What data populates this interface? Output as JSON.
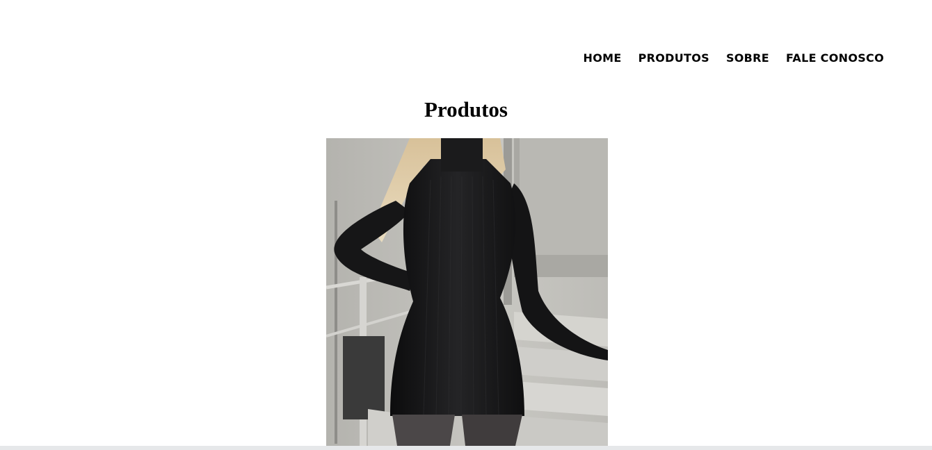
{
  "nav": {
    "items": [
      {
        "label": "HOME"
      },
      {
        "label": "PRODUTOS"
      },
      {
        "label": "SOBRE"
      },
      {
        "label": "FALE CONOSCO"
      }
    ]
  },
  "main": {
    "title": "Produtos"
  },
  "product_image": {
    "subject": "woman wearing black ribbed turtleneck mini dress on concrete stairs"
  }
}
